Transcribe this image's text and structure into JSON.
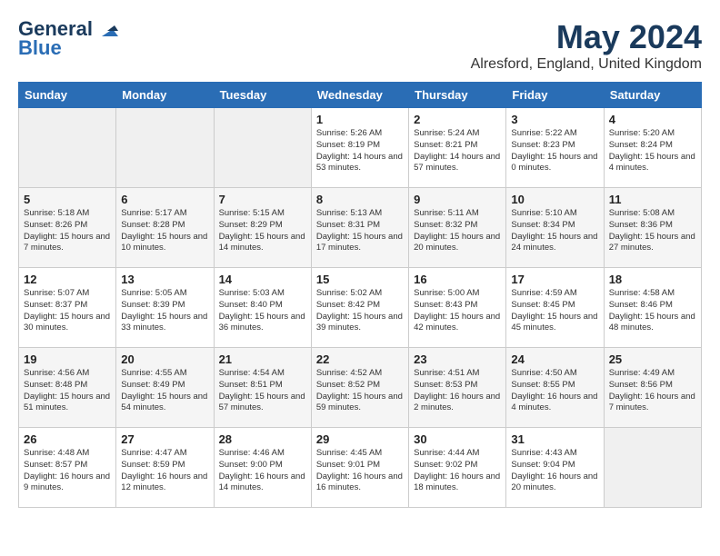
{
  "header": {
    "logo_line1": "General",
    "logo_line2": "Blue",
    "month_title": "May 2024",
    "location": "Alresford, England, United Kingdom"
  },
  "days_of_week": [
    "Sunday",
    "Monday",
    "Tuesday",
    "Wednesday",
    "Thursday",
    "Friday",
    "Saturday"
  ],
  "weeks": [
    [
      {
        "day": "",
        "content": ""
      },
      {
        "day": "",
        "content": ""
      },
      {
        "day": "",
        "content": ""
      },
      {
        "day": "1",
        "content": "Sunrise: 5:26 AM\nSunset: 8:19 PM\nDaylight: 14 hours and 53 minutes."
      },
      {
        "day": "2",
        "content": "Sunrise: 5:24 AM\nSunset: 8:21 PM\nDaylight: 14 hours and 57 minutes."
      },
      {
        "day": "3",
        "content": "Sunrise: 5:22 AM\nSunset: 8:23 PM\nDaylight: 15 hours and 0 minutes."
      },
      {
        "day": "4",
        "content": "Sunrise: 5:20 AM\nSunset: 8:24 PM\nDaylight: 15 hours and 4 minutes."
      }
    ],
    [
      {
        "day": "5",
        "content": "Sunrise: 5:18 AM\nSunset: 8:26 PM\nDaylight: 15 hours and 7 minutes."
      },
      {
        "day": "6",
        "content": "Sunrise: 5:17 AM\nSunset: 8:28 PM\nDaylight: 15 hours and 10 minutes."
      },
      {
        "day": "7",
        "content": "Sunrise: 5:15 AM\nSunset: 8:29 PM\nDaylight: 15 hours and 14 minutes."
      },
      {
        "day": "8",
        "content": "Sunrise: 5:13 AM\nSunset: 8:31 PM\nDaylight: 15 hours and 17 minutes."
      },
      {
        "day": "9",
        "content": "Sunrise: 5:11 AM\nSunset: 8:32 PM\nDaylight: 15 hours and 20 minutes."
      },
      {
        "day": "10",
        "content": "Sunrise: 5:10 AM\nSunset: 8:34 PM\nDaylight: 15 hours and 24 minutes."
      },
      {
        "day": "11",
        "content": "Sunrise: 5:08 AM\nSunset: 8:36 PM\nDaylight: 15 hours and 27 minutes."
      }
    ],
    [
      {
        "day": "12",
        "content": "Sunrise: 5:07 AM\nSunset: 8:37 PM\nDaylight: 15 hours and 30 minutes."
      },
      {
        "day": "13",
        "content": "Sunrise: 5:05 AM\nSunset: 8:39 PM\nDaylight: 15 hours and 33 minutes."
      },
      {
        "day": "14",
        "content": "Sunrise: 5:03 AM\nSunset: 8:40 PM\nDaylight: 15 hours and 36 minutes."
      },
      {
        "day": "15",
        "content": "Sunrise: 5:02 AM\nSunset: 8:42 PM\nDaylight: 15 hours and 39 minutes."
      },
      {
        "day": "16",
        "content": "Sunrise: 5:00 AM\nSunset: 8:43 PM\nDaylight: 15 hours and 42 minutes."
      },
      {
        "day": "17",
        "content": "Sunrise: 4:59 AM\nSunset: 8:45 PM\nDaylight: 15 hours and 45 minutes."
      },
      {
        "day": "18",
        "content": "Sunrise: 4:58 AM\nSunset: 8:46 PM\nDaylight: 15 hours and 48 minutes."
      }
    ],
    [
      {
        "day": "19",
        "content": "Sunrise: 4:56 AM\nSunset: 8:48 PM\nDaylight: 15 hours and 51 minutes."
      },
      {
        "day": "20",
        "content": "Sunrise: 4:55 AM\nSunset: 8:49 PM\nDaylight: 15 hours and 54 minutes."
      },
      {
        "day": "21",
        "content": "Sunrise: 4:54 AM\nSunset: 8:51 PM\nDaylight: 15 hours and 57 minutes."
      },
      {
        "day": "22",
        "content": "Sunrise: 4:52 AM\nSunset: 8:52 PM\nDaylight: 15 hours and 59 minutes."
      },
      {
        "day": "23",
        "content": "Sunrise: 4:51 AM\nSunset: 8:53 PM\nDaylight: 16 hours and 2 minutes."
      },
      {
        "day": "24",
        "content": "Sunrise: 4:50 AM\nSunset: 8:55 PM\nDaylight: 16 hours and 4 minutes."
      },
      {
        "day": "25",
        "content": "Sunrise: 4:49 AM\nSunset: 8:56 PM\nDaylight: 16 hours and 7 minutes."
      }
    ],
    [
      {
        "day": "26",
        "content": "Sunrise: 4:48 AM\nSunset: 8:57 PM\nDaylight: 16 hours and 9 minutes."
      },
      {
        "day": "27",
        "content": "Sunrise: 4:47 AM\nSunset: 8:59 PM\nDaylight: 16 hours and 12 minutes."
      },
      {
        "day": "28",
        "content": "Sunrise: 4:46 AM\nSunset: 9:00 PM\nDaylight: 16 hours and 14 minutes."
      },
      {
        "day": "29",
        "content": "Sunrise: 4:45 AM\nSunset: 9:01 PM\nDaylight: 16 hours and 16 minutes."
      },
      {
        "day": "30",
        "content": "Sunrise: 4:44 AM\nSunset: 9:02 PM\nDaylight: 16 hours and 18 minutes."
      },
      {
        "day": "31",
        "content": "Sunrise: 4:43 AM\nSunset: 9:04 PM\nDaylight: 16 hours and 20 minutes."
      },
      {
        "day": "",
        "content": ""
      }
    ]
  ]
}
